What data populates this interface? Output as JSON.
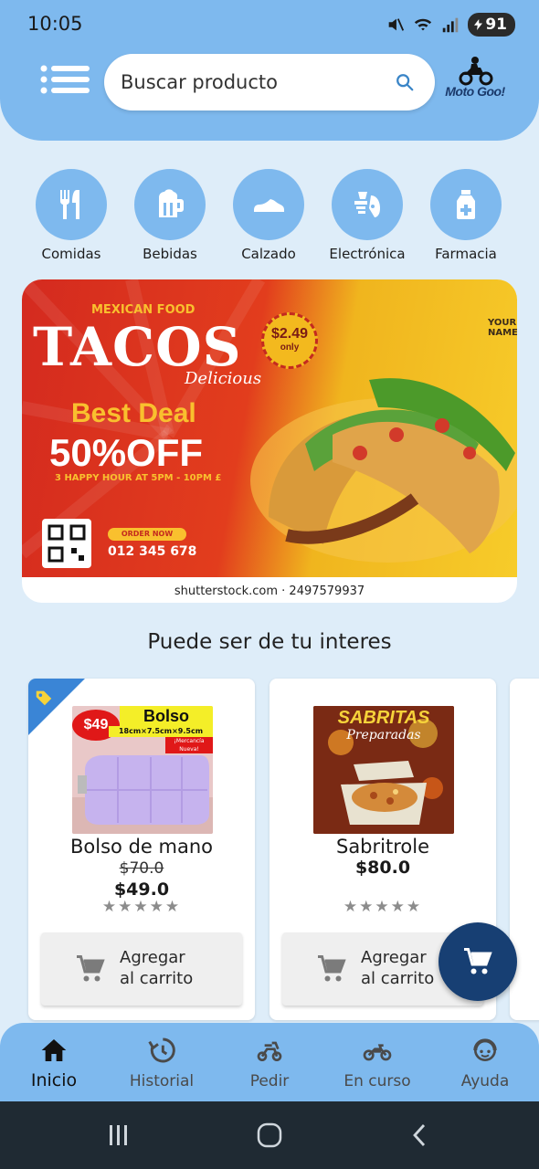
{
  "status_bar": {
    "time": "10:05",
    "battery": "91"
  },
  "header": {
    "search": {
      "placeholder": "Buscar producto"
    },
    "logo_text": "Moto Goo!"
  },
  "categories": [
    {
      "label": "Comidas",
      "icon": "utensils-icon"
    },
    {
      "label": "Bebidas",
      "icon": "beer-mug-icon"
    },
    {
      "label": "Calzado",
      "icon": "shoe-icon"
    },
    {
      "label": "Electrónica",
      "icon": "blender-icon"
    },
    {
      "label": "Farmacia",
      "icon": "medicine-bottle-icon"
    }
  ],
  "banner": {
    "tag": "MEXICAN FOOD",
    "title": "TACOS",
    "subtitle": "Delicious",
    "deal": "Best Deal",
    "discount": "50%OFF",
    "happy_hour": "3 HAPPY HOUR AT 5PM - 10PM £",
    "price": "$2.49",
    "price_note": "only",
    "order_label": "ORDER NOW",
    "phone": "012 345 678",
    "your_name": "YOUR NAME",
    "credit": "shutterstock.com · 2497579937"
  },
  "section_title": "Puede ser de tu interes",
  "products": [
    {
      "name": "Bolso de mano",
      "old_price": "$70.0",
      "price": "$49.0",
      "stars": "★★★★★",
      "img_price": "$49",
      "img_title": "Bolso",
      "img_size": "18cm×7.5cm×9.5cm",
      "img_badge": "¡Mercancía Nueva!",
      "add_label_1": "Agregar",
      "add_label_2": "al carrito"
    },
    {
      "name": "Sabritrole",
      "price": "$80.0",
      "stars": "★★★★★",
      "img_title": "SABRITAS",
      "img_sub": "Preparadas",
      "add_label_1": "Agregar",
      "add_label_2": "al carrito"
    }
  ],
  "bottom_nav": [
    {
      "label": "Inicio",
      "icon": "home-icon",
      "active": true
    },
    {
      "label": "Historial",
      "icon": "history-icon"
    },
    {
      "label": "Pedir",
      "icon": "scooter-icon"
    },
    {
      "label": "En curso",
      "icon": "motorcycle-icon"
    },
    {
      "label": "Ayuda",
      "icon": "support-face-icon"
    }
  ],
  "colors": {
    "primary": "#7eb9ee",
    "background": "#deedf9",
    "fab": "#173f73",
    "tag": "#3a85d6"
  }
}
